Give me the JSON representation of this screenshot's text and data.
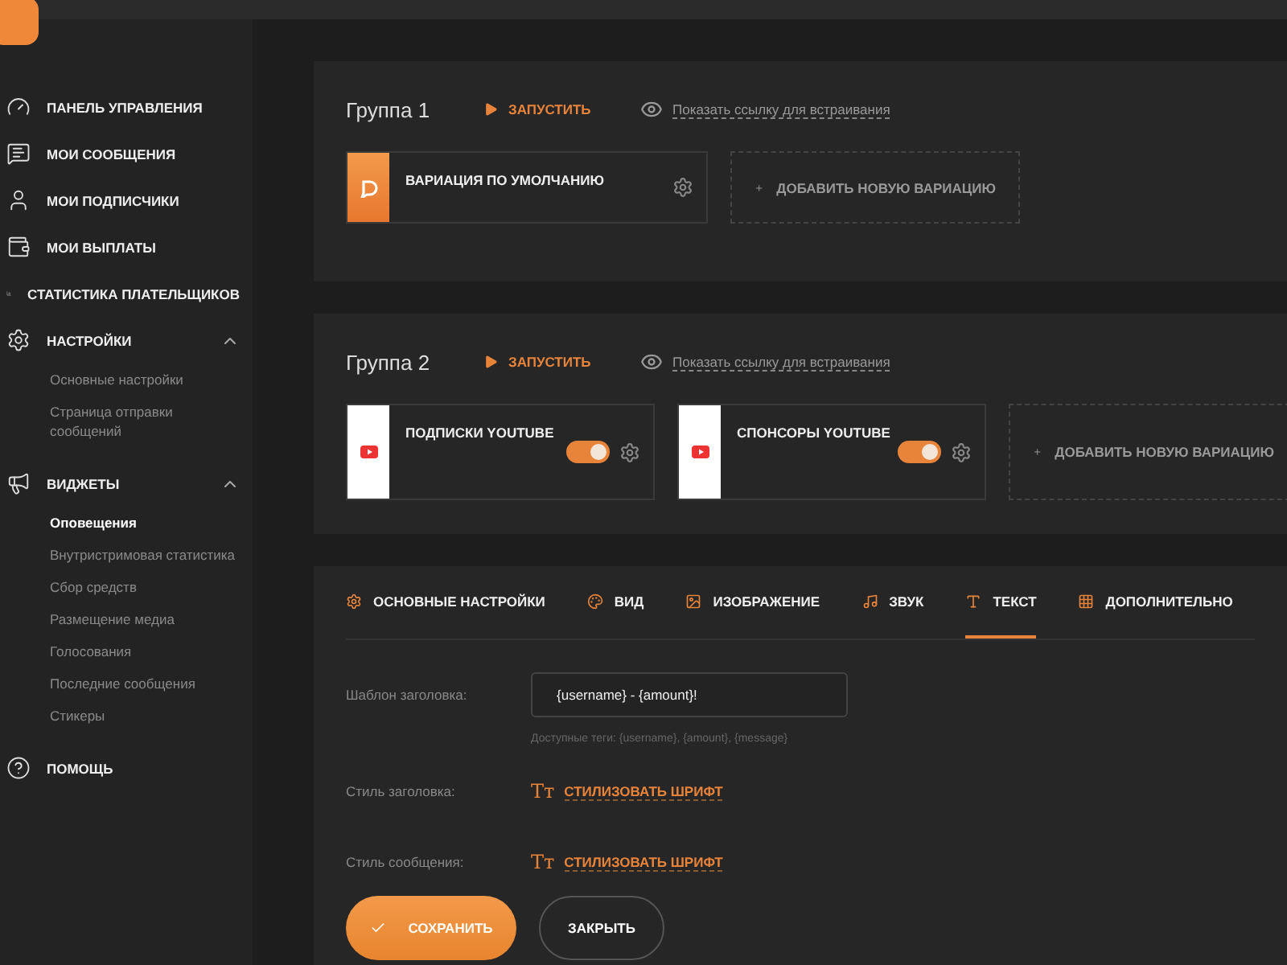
{
  "sidebar": {
    "items": [
      {
        "label": "ПАНЕЛЬ УПРАВЛЕНИЯ"
      },
      {
        "label": "МОИ СООБЩЕНИЯ"
      },
      {
        "label": "МОИ ПОДПИСЧИКИ"
      },
      {
        "label": "МОИ ВЫПЛАТЫ"
      },
      {
        "label": "СТАТИСТИКА ПЛАТЕЛЬЩИКОВ"
      },
      {
        "label": "НАСТРОЙКИ",
        "expanded": true,
        "children": [
          {
            "label": "Основные настройки",
            "selected": false
          },
          {
            "label": "Страница отправки сообщений",
            "selected": false
          }
        ]
      },
      {
        "label": "ВИДЖЕТЫ",
        "expanded": true,
        "children": [
          {
            "label": "Оповещения",
            "selected": true
          },
          {
            "label": "Внутристримовая статистика",
            "selected": false
          },
          {
            "label": "Сбор средств",
            "selected": false
          },
          {
            "label": "Размещение медиа",
            "selected": false
          },
          {
            "label": "Голосования",
            "selected": false
          },
          {
            "label": "Последние сообщения",
            "selected": false
          },
          {
            "label": "Стикеры",
            "selected": false
          }
        ]
      },
      {
        "label": "ПОМОЩЬ"
      }
    ]
  },
  "groups": [
    {
      "title": "Группа 1",
      "run": "ЗАПУСТИТЬ",
      "embed": "Показать ссылку для встраивания",
      "add": "ДОБАВИТЬ НОВУЮ ВАРИАЦИЮ",
      "variations": [
        {
          "kind": "default",
          "name": "ВАРИАЦИЯ ПО УМОЛЧАНИЮ"
        }
      ]
    },
    {
      "title": "Группа 2",
      "run": "ЗАПУСТИТЬ",
      "embed": "Показать ссылку для встраивания",
      "add": "ДОБАВИТЬ НОВУЮ ВАРИАЦИЮ",
      "variations": [
        {
          "kind": "youtube",
          "name": "ПОДПИСКИ YOUTUBE",
          "on": true
        },
        {
          "kind": "youtube",
          "name": "СПОНСОРЫ YOUTUBE",
          "on": true
        }
      ]
    }
  ],
  "settings": {
    "tabs": [
      {
        "label": "ОСНОВНЫЕ НАСТРОЙКИ",
        "selected": false
      },
      {
        "label": "ВИД",
        "selected": false
      },
      {
        "label": "ИЗОБРАЖЕНИЕ",
        "selected": false
      },
      {
        "label": "ЗВУК",
        "selected": false
      },
      {
        "label": "ТЕКСТ",
        "selected": true
      },
      {
        "label": "ДОПОЛНИТЕЛЬНО",
        "selected": false
      }
    ],
    "template": {
      "label": "Шаблон заголовка:",
      "value": "{username} - {amount}!",
      "hint": "Доступные теги: {username}, {amount}, {message}"
    },
    "styles": [
      {
        "label": "Стиль заголовка:",
        "glyph": "Тт",
        "link": "СТИЛИЗОВАТЬ ШРИФТ"
      },
      {
        "label": "Стиль сообщения:",
        "glyph": "Тт",
        "link": "СТИЛИЗОВАТЬ ШРИФТ"
      }
    ],
    "buttons": {
      "save": "СОХРАНИТЬ",
      "close": "ЗАКРЫТЬ"
    }
  }
}
